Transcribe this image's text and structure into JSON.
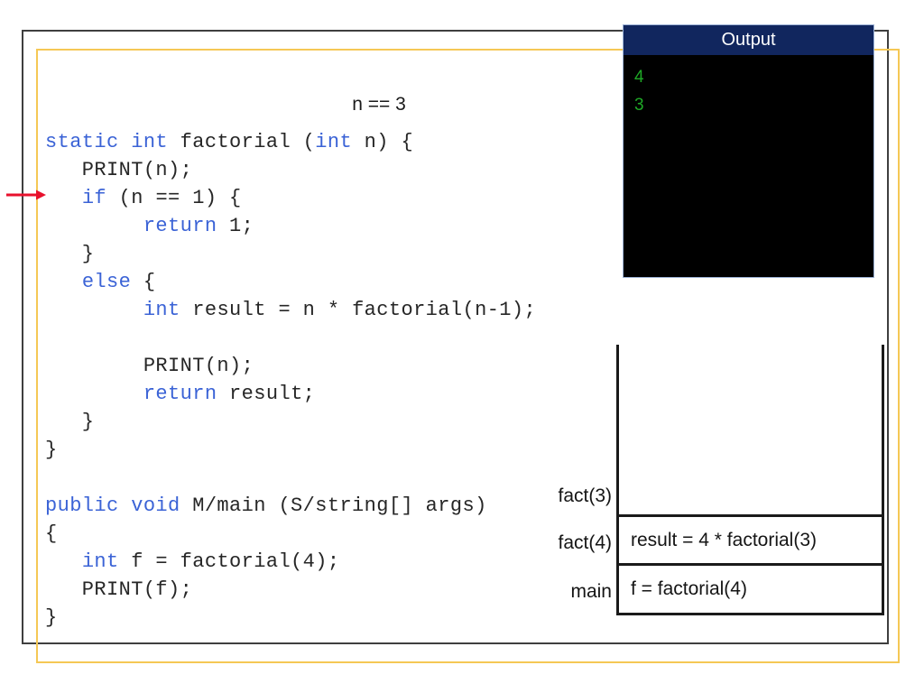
{
  "slide": {
    "annotation": "n == 3"
  },
  "code": {
    "lines": [
      {
        "segments": [
          {
            "t": "static int",
            "kw": true
          },
          {
            "t": " factorial (",
            "kw": false
          },
          {
            "t": "int",
            "kw": true
          },
          {
            "t": " n) {",
            "kw": false
          }
        ]
      },
      {
        "segments": [
          {
            "t": "   PRINT(n);",
            "kw": false
          }
        ]
      },
      {
        "segments": [
          {
            "t": "   ",
            "kw": false
          },
          {
            "t": "if",
            "kw": true
          },
          {
            "t": " (n == 1) {",
            "kw": false
          }
        ]
      },
      {
        "segments": [
          {
            "t": "        ",
            "kw": false
          },
          {
            "t": "return",
            "kw": true
          },
          {
            "t": " 1;",
            "kw": false
          }
        ]
      },
      {
        "segments": [
          {
            "t": "   }",
            "kw": false
          }
        ]
      },
      {
        "segments": [
          {
            "t": "   ",
            "kw": false
          },
          {
            "t": "else",
            "kw": true
          },
          {
            "t": " {",
            "kw": false
          }
        ]
      },
      {
        "wrapped": true,
        "segments": [
          {
            "t": "        ",
            "kw": false
          },
          {
            "t": "int",
            "kw": true
          },
          {
            "t": " result = n * factorial(n-1);",
            "kw": false
          }
        ]
      },
      {
        "segments": [
          {
            "t": "        PRINT(n);",
            "kw": false
          }
        ]
      },
      {
        "segments": [
          {
            "t": "        ",
            "kw": false
          },
          {
            "t": "return",
            "kw": true
          },
          {
            "t": " result;",
            "kw": false
          }
        ]
      },
      {
        "segments": [
          {
            "t": "   }",
            "kw": false
          }
        ]
      },
      {
        "segments": [
          {
            "t": "}",
            "kw": false
          }
        ]
      },
      {
        "blank": true,
        "segments": []
      },
      {
        "segments": [
          {
            "t": "public void",
            "kw": true
          },
          {
            "t": " M/main (S/string[] args)",
            "kw": false
          }
        ]
      },
      {
        "segments": [
          {
            "t": "{",
            "kw": false
          }
        ]
      },
      {
        "segments": [
          {
            "t": "   ",
            "kw": false
          },
          {
            "t": "int",
            "kw": true
          },
          {
            "t": " f = factorial(4);",
            "kw": false
          }
        ]
      },
      {
        "segments": [
          {
            "t": "   PRINT(f);",
            "kw": false
          }
        ]
      },
      {
        "segments": [
          {
            "t": "}",
            "kw": false
          }
        ]
      }
    ]
  },
  "output": {
    "title": "Output",
    "console_lines": [
      "4",
      "3"
    ],
    "text_color": "#1ea826",
    "header_color": "#11265e",
    "body_color": "#000000"
  },
  "call_stack": {
    "frames": [
      {
        "label": "fact(3)",
        "content": ""
      },
      {
        "label": "fact(4)",
        "content": "result = 4 * factorial(3)"
      },
      {
        "label": "main",
        "content": "f = factorial(4)"
      }
    ]
  },
  "colors": {
    "keyword": "#3b63d6",
    "outer_frame": "#3f3f3f",
    "gold_frame": "#f5c855",
    "arrow": "#e8112d"
  }
}
